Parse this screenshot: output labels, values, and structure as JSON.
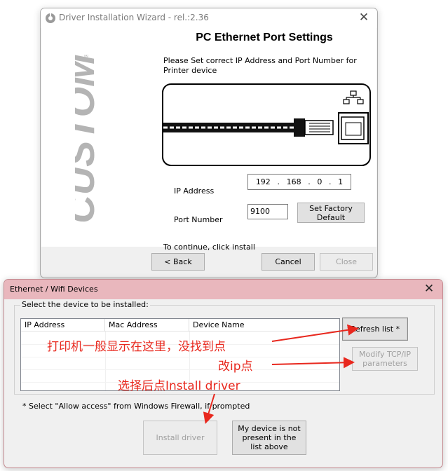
{
  "wizard": {
    "title": "Driver Installation Wizard - rel.:2.36",
    "heading": "PC Ethernet Port Settings",
    "instruction": "Please Set correct IP Address and Port Number for Printer device",
    "logo_text": "CUSTOM",
    "ip_label": "IP Address",
    "ip_octets": [
      "192",
      "168",
      "0",
      "1"
    ],
    "port_label": "Port Number",
    "port_value": "9100",
    "factory_button": "Set Factory Default",
    "continue_text": "To continue, click install",
    "back_button": "< Back",
    "cancel_button": "Cancel",
    "close_button": "Close"
  },
  "devices": {
    "title": "Ethernet / Wifi Devices",
    "group_label": "Select the device to be installed:",
    "columns": [
      "IP Address",
      "Mac Address",
      "Device Name"
    ],
    "refresh_button": "Refresh list *",
    "modify_button": "Modify TCP/IP parameters",
    "note": "* Select \"Allow access\" from Windows Firewall, if prompted",
    "install_button": "Install driver",
    "not_present_button": "My device is not present in the list above"
  },
  "annotations": {
    "line1": "打印机一般显示在这里，没找到点",
    "line2": "改ip点",
    "line3": "选择后点Install driver"
  },
  "colors": {
    "annotation": "#e8281e",
    "devices_titlebar": "#e9b7bd",
    "logo_gray": "#b4b4b4"
  }
}
